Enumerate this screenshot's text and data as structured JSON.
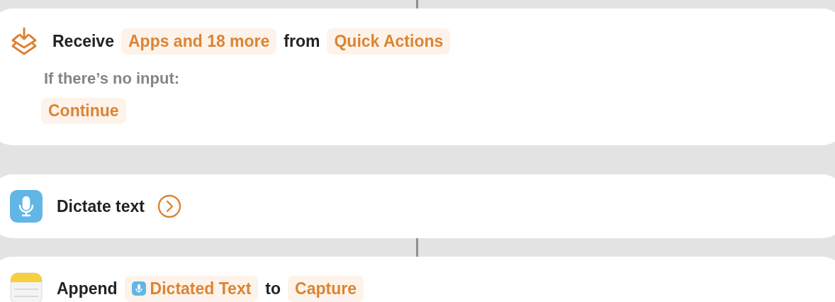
{
  "actions": [
    {
      "parts": [
        {
          "kind": "word",
          "text": "Receive"
        },
        {
          "kind": "token",
          "text": "Apps and 18 more"
        },
        {
          "kind": "word",
          "text": "from"
        },
        {
          "kind": "token",
          "text": "Quick Actions"
        }
      ],
      "fallback": {
        "label": "If there’s no input:",
        "value": "Continue"
      }
    },
    {
      "parts": [
        {
          "kind": "word",
          "text": "Dictate text"
        }
      ]
    },
    {
      "parts": [
        {
          "kind": "word",
          "text": "Append"
        },
        {
          "kind": "variable",
          "text": "Dictated Text"
        },
        {
          "kind": "word",
          "text": "to"
        },
        {
          "kind": "token",
          "text": "Capture"
        }
      ]
    }
  ]
}
